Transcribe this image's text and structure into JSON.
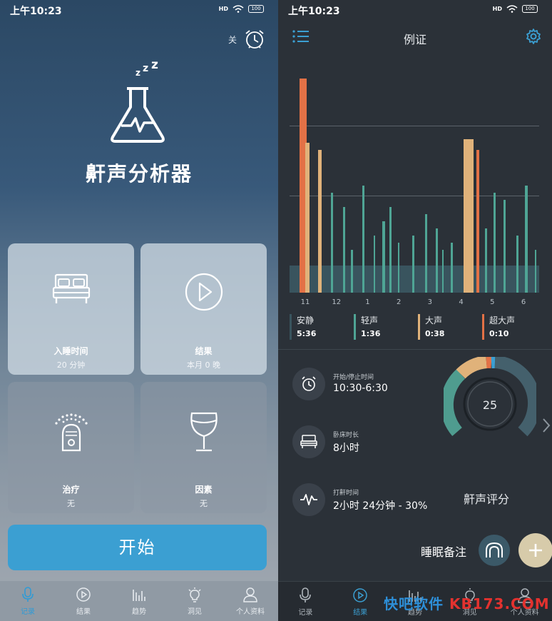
{
  "status": {
    "time": "上午10:23",
    "hd": "HD",
    "battery": "100"
  },
  "left": {
    "alarm_state": "关",
    "app_title": "鼾声分析器",
    "tiles": [
      {
        "label": "入睡时间",
        "value": "20 分钟",
        "icon": "bed-icon"
      },
      {
        "label": "结果",
        "value": "本月 0 晚",
        "icon": "play-icon"
      },
      {
        "label": "治疗",
        "value": "无",
        "icon": "remedy-device-icon"
      },
      {
        "label": "因素",
        "value": "无",
        "icon": "wine-glass-icon"
      }
    ],
    "start_label": "开始",
    "tabs": [
      {
        "label": "记录",
        "icon": "microphone-icon",
        "active": true
      },
      {
        "label": "结果",
        "icon": "play-circle-icon",
        "active": false
      },
      {
        "label": "趋势",
        "icon": "bar-chart-icon",
        "active": false
      },
      {
        "label": "洞见",
        "icon": "lightbulb-icon",
        "active": false
      },
      {
        "label": "个人资料",
        "icon": "person-icon",
        "active": false
      }
    ]
  },
  "right": {
    "title": "例证",
    "chart_data": {
      "type": "bar",
      "x_ticks": [
        "11",
        "12",
        "1",
        "2",
        "3",
        "4",
        "5",
        "6"
      ],
      "series": [
        {
          "name": "安静",
          "total": "5:36",
          "color": "#39545e"
        },
        {
          "name": "轻声",
          "total": "1:36",
          "color": "#4fa595"
        },
        {
          "name": "大声",
          "total": "0:38",
          "color": "#e0b27a"
        },
        {
          "name": "超大声",
          "total": "0:10",
          "color": "#e37146"
        }
      ]
    },
    "stats": [
      {
        "label": "开始/停止时间",
        "value": "10:30-6:30",
        "icon": "alarm-clock-icon"
      },
      {
        "label": "卧床时长",
        "value": "8小时",
        "icon": "bed-icon"
      },
      {
        "label": "打鼾时间",
        "value": "2小时 24分钟 - 30%",
        "icon": "waveform-icon"
      }
    ],
    "score": "25",
    "score_label": "鼾声评分",
    "note_label": "睡眠备注",
    "tabs": [
      {
        "label": "记录",
        "icon": "microphone-icon",
        "active": false
      },
      {
        "label": "结果",
        "icon": "play-circle-icon",
        "active": true
      },
      {
        "label": "趋势",
        "icon": "bar-chart-icon",
        "active": false
      },
      {
        "label": "洞见",
        "icon": "lightbulb-icon",
        "active": false
      },
      {
        "label": "个人资料",
        "icon": "person-icon",
        "active": false
      }
    ]
  },
  "watermark": {
    "part1": "快吧软件",
    "part2": "KB173.COM"
  }
}
